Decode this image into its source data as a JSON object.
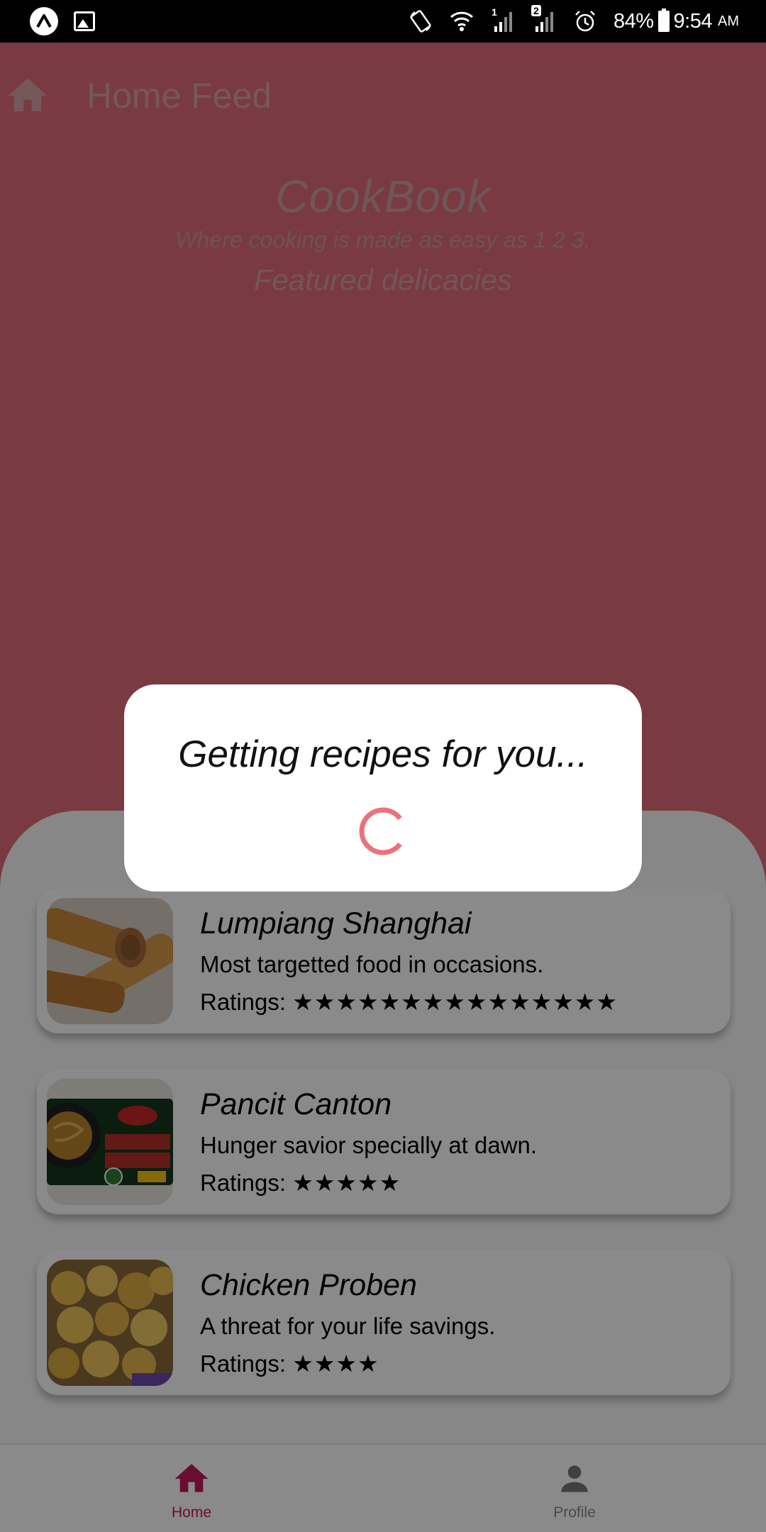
{
  "status_bar": {
    "battery": "84%",
    "time": "9:54",
    "ampm": "AM",
    "sim1": "1",
    "sim2": "2",
    "icons": [
      "app-notification-icon",
      "gallery-icon",
      "rotate-icon",
      "wifi-icon",
      "signal-icon",
      "signal-icon",
      "alarm-icon",
      "battery-icon"
    ]
  },
  "header": {
    "title": "Home Feed",
    "icon": "home-icon"
  },
  "brand": {
    "title": "CookBook",
    "tagline": "Where cooking is made as easy as 1 2 3.",
    "featured": "Featured delicacies"
  },
  "recipes": [
    {
      "name": "Lumpiang Shanghai",
      "description": "Most targetted food in occasions.",
      "rating_label": "Ratings:",
      "stars": "★★★★★★★★★★★★★★★"
    },
    {
      "name": "Pancit Canton",
      "description": "Hunger savior specially at dawn.",
      "rating_label": "Ratings:",
      "stars": "★★★★★"
    },
    {
      "name": "Chicken Proben",
      "description": "A threat for your life savings.",
      "rating_label": "Ratings:",
      "stars": "★★★★"
    }
  ],
  "dialog": {
    "message": "Getting recipes for you..."
  },
  "bottom_nav": {
    "items": [
      {
        "label": "Home",
        "icon": "home-icon",
        "active": true
      },
      {
        "label": "Profile",
        "icon": "person-icon",
        "active": false
      }
    ]
  },
  "colors": {
    "background": "#e26c78",
    "accent": "#c2185b",
    "spinner": "#ee7079"
  }
}
